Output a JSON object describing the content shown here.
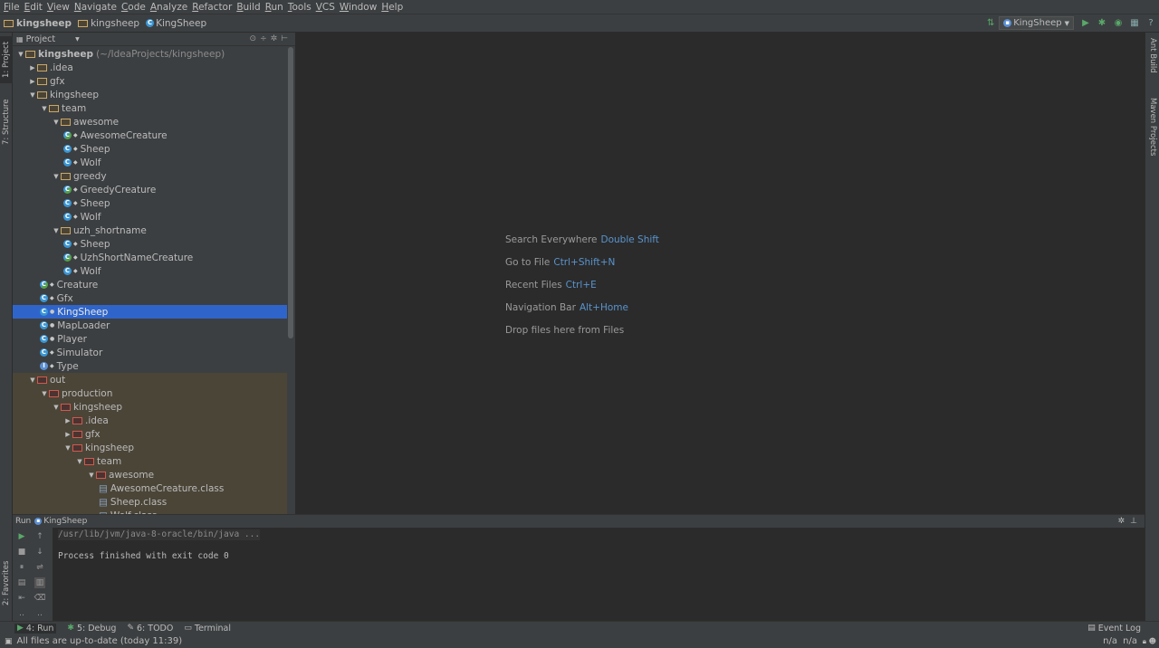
{
  "menu": [
    "File",
    "Edit",
    "View",
    "Navigate",
    "Code",
    "Analyze",
    "Refactor",
    "Build",
    "Run",
    "Tools",
    "VCS",
    "Window",
    "Help"
  ],
  "breadcrumbs": {
    "root": "kingsheep",
    "pkg": "kingsheep",
    "cls": "KingSheep"
  },
  "run_config": "KingSheep",
  "left_tabs": {
    "project": "1: Project",
    "structure": "7: Structure",
    "favorites": "2: Favorites"
  },
  "right_tabs": {
    "ant": "Ant Build",
    "maven": "Maven Projects"
  },
  "project_panel": {
    "title": "Project"
  },
  "tree": [
    {
      "depth": 0,
      "arrow": "down",
      "icon": "folder",
      "label": "kingsheep",
      "extra": "(~/IdeaProjects/kingsheep)",
      "bold": true
    },
    {
      "depth": 1,
      "arrow": "right",
      "icon": "folder",
      "label": ".idea"
    },
    {
      "depth": 1,
      "arrow": "right",
      "icon": "folder",
      "label": "gfx"
    },
    {
      "depth": 1,
      "arrow": "down",
      "icon": "folder",
      "label": "kingsheep"
    },
    {
      "depth": 2,
      "arrow": "down",
      "icon": "folder",
      "label": "team"
    },
    {
      "depth": 3,
      "arrow": "down",
      "icon": "folder",
      "label": "awesome"
    },
    {
      "depth": 4,
      "arrow": "",
      "icon": "abstract",
      "label": "AwesomeCreature"
    },
    {
      "depth": 4,
      "arrow": "",
      "icon": "class",
      "label": "Sheep"
    },
    {
      "depth": 4,
      "arrow": "",
      "icon": "class",
      "label": "Wolf"
    },
    {
      "depth": 3,
      "arrow": "down",
      "icon": "folder",
      "label": "greedy"
    },
    {
      "depth": 4,
      "arrow": "",
      "icon": "abstract",
      "label": "GreedyCreature"
    },
    {
      "depth": 4,
      "arrow": "",
      "icon": "class",
      "label": "Sheep"
    },
    {
      "depth": 4,
      "arrow": "",
      "icon": "class",
      "label": "Wolf"
    },
    {
      "depth": 3,
      "arrow": "down",
      "icon": "folder",
      "label": "uzh_shortname"
    },
    {
      "depth": 4,
      "arrow": "",
      "icon": "class",
      "label": "Sheep"
    },
    {
      "depth": 4,
      "arrow": "",
      "icon": "abstract",
      "label": "UzhShortNameCreature"
    },
    {
      "depth": 4,
      "arrow": "",
      "icon": "class",
      "label": "Wolf"
    },
    {
      "depth": 2,
      "arrow": "",
      "icon": "abstract",
      "label": "Creature"
    },
    {
      "depth": 2,
      "arrow": "",
      "icon": "class",
      "label": "Gfx"
    },
    {
      "depth": 2,
      "arrow": "",
      "icon": "class",
      "label": "KingSheep",
      "selected": true
    },
    {
      "depth": 2,
      "arrow": "",
      "icon": "class",
      "label": "MapLoader"
    },
    {
      "depth": 2,
      "arrow": "",
      "icon": "class",
      "label": "Player"
    },
    {
      "depth": 2,
      "arrow": "",
      "icon": "class",
      "label": "Simulator"
    },
    {
      "depth": 2,
      "arrow": "",
      "icon": "iface",
      "label": "Type"
    },
    {
      "depth": 1,
      "arrow": "down",
      "icon": "folder-red",
      "label": "out",
      "out": true
    },
    {
      "depth": 2,
      "arrow": "down",
      "icon": "folder-red",
      "label": "production",
      "out": true
    },
    {
      "depth": 3,
      "arrow": "down",
      "icon": "folder-red",
      "label": "kingsheep",
      "out": true
    },
    {
      "depth": 4,
      "arrow": "right",
      "icon": "folder-red",
      "label": ".idea",
      "out": true
    },
    {
      "depth": 4,
      "arrow": "right",
      "icon": "folder-red",
      "label": "gfx",
      "out": true
    },
    {
      "depth": 4,
      "arrow": "down",
      "icon": "folder-red",
      "label": "kingsheep",
      "out": true
    },
    {
      "depth": 5,
      "arrow": "down",
      "icon": "folder-red",
      "label": "team",
      "out": true
    },
    {
      "depth": 6,
      "arrow": "down",
      "icon": "folder-red",
      "label": "awesome",
      "out": true
    },
    {
      "depth": 7,
      "arrow": "",
      "icon": "file",
      "label": "AwesomeCreature.class",
      "out": true
    },
    {
      "depth": 7,
      "arrow": "",
      "icon": "file",
      "label": "Sheep.class",
      "out": true
    },
    {
      "depth": 7,
      "arrow": "",
      "icon": "file",
      "label": "Wolf.class",
      "out": true
    }
  ],
  "editor_hints": [
    {
      "text": "Search Everywhere",
      "key": "Double Shift"
    },
    {
      "text": "Go to File",
      "key": "Ctrl+Shift+N"
    },
    {
      "text": "Recent Files",
      "key": "Ctrl+E"
    },
    {
      "text": "Navigation Bar",
      "key": "Alt+Home"
    },
    {
      "text": "Drop files here from Files",
      "key": ""
    }
  ],
  "run_panel": {
    "label": "Run",
    "config": "KingSheep"
  },
  "console": [
    "/usr/lib/jvm/java-8-oracle/bin/java ...",
    "",
    "Process finished with exit code 0"
  ],
  "bottom_tabs": [
    {
      "label": "4: Run",
      "icon": "run-icon"
    },
    {
      "label": "5: Debug",
      "icon": "debug-icon"
    },
    {
      "label": "6: TODO",
      "icon": "todo-icon"
    },
    {
      "label": "Terminal",
      "icon": "terminal-icon"
    }
  ],
  "event_log": "Event Log",
  "status": {
    "message": "All files are up-to-date (today 11:39)",
    "pos1": "n/a",
    "pos2": "n/a"
  },
  "colors": {
    "selection": "#2f65ca",
    "link": "#5994ce",
    "run_green": "#59a869"
  }
}
